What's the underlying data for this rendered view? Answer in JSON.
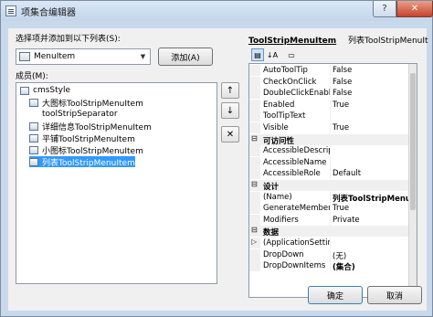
{
  "window": {
    "title": "项集合编辑器",
    "help_label": "?",
    "close_label": "✕"
  },
  "select_label": "选择项并添加到以下列表(S):",
  "combo": {
    "value": "MenuItem",
    "arrow": "▼"
  },
  "add_button": "添加(A)",
  "members_label": "成员(M):",
  "members": [
    {
      "label": "cmsStyle",
      "icon": true,
      "selected": false
    },
    {
      "label": "大图标ToolStripMenuItem",
      "icon": true,
      "selected": false
    },
    {
      "label": "toolStripSeparator",
      "icon": false,
      "selected": false
    },
    {
      "label": "详细信息ToolStripMenuItem",
      "icon": true,
      "selected": false
    },
    {
      "label": "平铺ToolStripMenuItem",
      "icon": true,
      "selected": false
    },
    {
      "label": "小图标ToolStripMenuItem",
      "icon": true,
      "selected": false
    },
    {
      "label": "列表ToolStripMenuItem",
      "icon": true,
      "selected": true
    }
  ],
  "move_buttons": {
    "up": "↑",
    "down": "↓",
    "delete": "✕"
  },
  "props": {
    "type_name": "ToolStripMenuItem",
    "object_name": "列表ToolStripMenuIt",
    "toolbar": {
      "categorized": "▤",
      "alphabetical": "↓A",
      "pages": "▭"
    },
    "rows": [
      {
        "kind": "prop",
        "name": "AutoToolTip",
        "value": "False"
      },
      {
        "kind": "prop",
        "name": "CheckOnClick",
        "value": "False"
      },
      {
        "kind": "prop",
        "name": "DoubleClickEnable",
        "value": "False"
      },
      {
        "kind": "prop",
        "name": "Enabled",
        "value": "True"
      },
      {
        "kind": "prop",
        "name": "ToolTipText",
        "value": ""
      },
      {
        "kind": "prop",
        "name": "Visible",
        "value": "True"
      },
      {
        "kind": "cat",
        "name": "可访问性"
      },
      {
        "kind": "prop",
        "name": "AccessibleDescrip",
        "value": ""
      },
      {
        "kind": "prop",
        "name": "AccessibleName",
        "value": ""
      },
      {
        "kind": "prop",
        "name": "AccessibleRole",
        "value": "Default"
      },
      {
        "kind": "cat",
        "name": "设计"
      },
      {
        "kind": "prop",
        "name": "(Name)",
        "value": "列表ToolStripMenuIt",
        "bold": true
      },
      {
        "kind": "prop",
        "name": "GenerateMember",
        "value": "True"
      },
      {
        "kind": "prop",
        "name": "Modifiers",
        "value": "Private"
      },
      {
        "kind": "cat",
        "name": "数据"
      },
      {
        "kind": "prop",
        "name": "(ApplicationSetting",
        "value": "",
        "expand": true
      },
      {
        "kind": "prop",
        "name": "DropDown",
        "value": "(无)"
      },
      {
        "kind": "prop",
        "name": "DropDownItems",
        "value": "(集合)",
        "bold": true
      }
    ]
  },
  "ok_button": "确定",
  "cancel_button": "取消"
}
